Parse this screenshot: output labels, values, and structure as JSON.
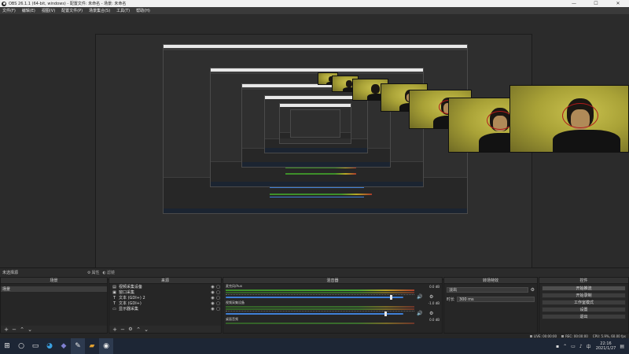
{
  "window": {
    "title": "OBS 26.1.1 (64-bit, windows) - 配置文件: 未命名 - 场景: 未命名",
    "minimize": "—",
    "maximize": "☐",
    "close": "✕"
  },
  "menu": [
    "文件(F)",
    "编辑(E)",
    "视图(V)",
    "配置文件(P)",
    "场景集合(S)",
    "工具(T)",
    "帮助(H)"
  ],
  "scene_bar": {
    "current_scene": "未选择源",
    "tab_properties": "属性",
    "tab_filters": "滤镜"
  },
  "docks": {
    "scenes": {
      "title": "场景",
      "items": [
        "场景"
      ]
    },
    "sources": {
      "title": "来源",
      "items": [
        {
          "icon": "video-capture-icon",
          "glyph": "▤",
          "name": "视频采集设备"
        },
        {
          "icon": "display-capture-icon",
          "glyph": "▣",
          "name": "窗口采集"
        },
        {
          "icon": "text-icon",
          "glyph": "T",
          "name": "文本 (GDI+) 2"
        },
        {
          "icon": "text-icon",
          "glyph": "T",
          "name": "文本 (GDI+)"
        },
        {
          "icon": "monitor-icon",
          "glyph": "▭",
          "name": "显示器采集"
        }
      ]
    },
    "mixer": {
      "title": "混音器",
      "channels": [
        {
          "name": "麦克风/Aux",
          "db": "0.0 dB",
          "level": 0.93
        },
        {
          "name": "视频采集设备",
          "db": "-1.0 dB",
          "level": 0.9
        },
        {
          "name": "桌面音频",
          "db": "0.0 dB",
          "level": 0.5
        }
      ]
    },
    "transitions": {
      "title": "转场特效",
      "selected": "淡出",
      "duration_label": "时长",
      "duration_value": "300 ms"
    },
    "controls": {
      "title": "控件",
      "buttons": [
        "开始推流",
        "开始录制",
        "工作室模式",
        "设置",
        "退出"
      ]
    }
  },
  "status": {
    "live": "LIVE: 00:00:00",
    "rec": "REC: 00:00:00",
    "cpu": "CPU: 5.9%, 60.00 fps"
  },
  "taskbar": {
    "clock_time": "22:16",
    "clock_date": "2021/1/27"
  }
}
